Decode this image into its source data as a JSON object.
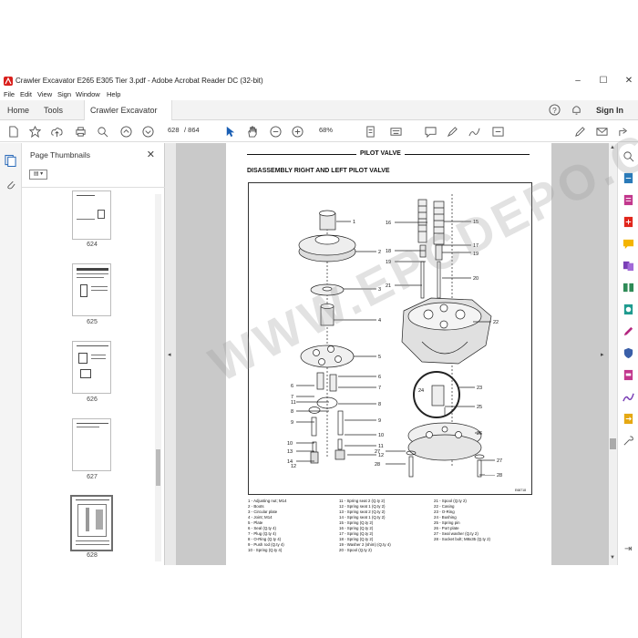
{
  "window": {
    "title": "Crawler Excavator E265 E305 Tier 3.pdf - Adobe Acrobat Reader DC (32-bit)",
    "minimize": "–",
    "maximize": "☐",
    "close": "✕"
  },
  "menu": [
    "File",
    "Edit",
    "View",
    "Sign",
    "Window",
    "Help"
  ],
  "tabs": {
    "home": "Home",
    "tools": "Tools",
    "document": "Crawler Excavator E...",
    "close": "×",
    "signin": "Sign In"
  },
  "toolbar": {
    "current_page": "628",
    "total_pages": "/ 864",
    "zoom": "68%"
  },
  "thumbnails": {
    "title": "Page Thumbnails",
    "labels": [
      "624",
      "625",
      "626",
      "627",
      "628"
    ]
  },
  "document": {
    "header": "PILOT VALVE",
    "heading": "DISASSEMBLY RIGHT AND LEFT PILOT VALVE",
    "figure_code": "E68718",
    "part_numbers": [
      "1",
      "2",
      "3",
      "4",
      "5",
      "6",
      "7",
      "8",
      "9",
      "10",
      "11",
      "12",
      "13",
      "14",
      "6",
      "7",
      "8",
      "9",
      "10",
      "11",
      "12",
      "15",
      "16",
      "17",
      "18",
      "19",
      "19",
      "20",
      "21",
      "22",
      "23",
      "24",
      "25",
      "26",
      "27",
      "28",
      "27",
      "28"
    ],
    "legend_col1": [
      "1 - Adjusting nut; M14",
      "2 - Boots",
      "3 - Circular plate",
      "4 - Joint; M14",
      "5 - Plate",
      "6 - Seal (Q.ty 4)",
      "7 - Plug (Q.ty 4)",
      "8 - O-Ring (Q.ty 4)",
      "9 - Push rod (Q.ty 4)",
      "10 - Spring (Q.ty 4)"
    ],
    "legend_col2": [
      "11 - Spring seat 2 (Q.ty 2)",
      "12 - Spring seat 1 (Q.ty 2)",
      "13 - Spring seat 2 (Q.ty 2)",
      "14 - Spring seat 1 (Q.ty 2)",
      "15 - Spring (Q.ty 2)",
      "16 - Spring (Q.ty 2)",
      "17 - Spring (Q.ty 2)",
      "18 - Spring (Q.ty 2)",
      "19 - Washer 2 (shim) (Q.ty 4)",
      "20 - Spool (Q.ty 2)"
    ],
    "legend_col3": [
      "21 - Spool (Q.ty 2)",
      "22 - Casing",
      "23 - O-Ring",
      "24 - Bushing",
      "25 - Spring pin",
      "26 - Port plate",
      "27 - Seal washer (Q.ty 2)",
      "28 - Socket bolt; M8x35 (Q.ty 2)"
    ],
    "watermark": "WWW.EPCDEPO.COM"
  }
}
